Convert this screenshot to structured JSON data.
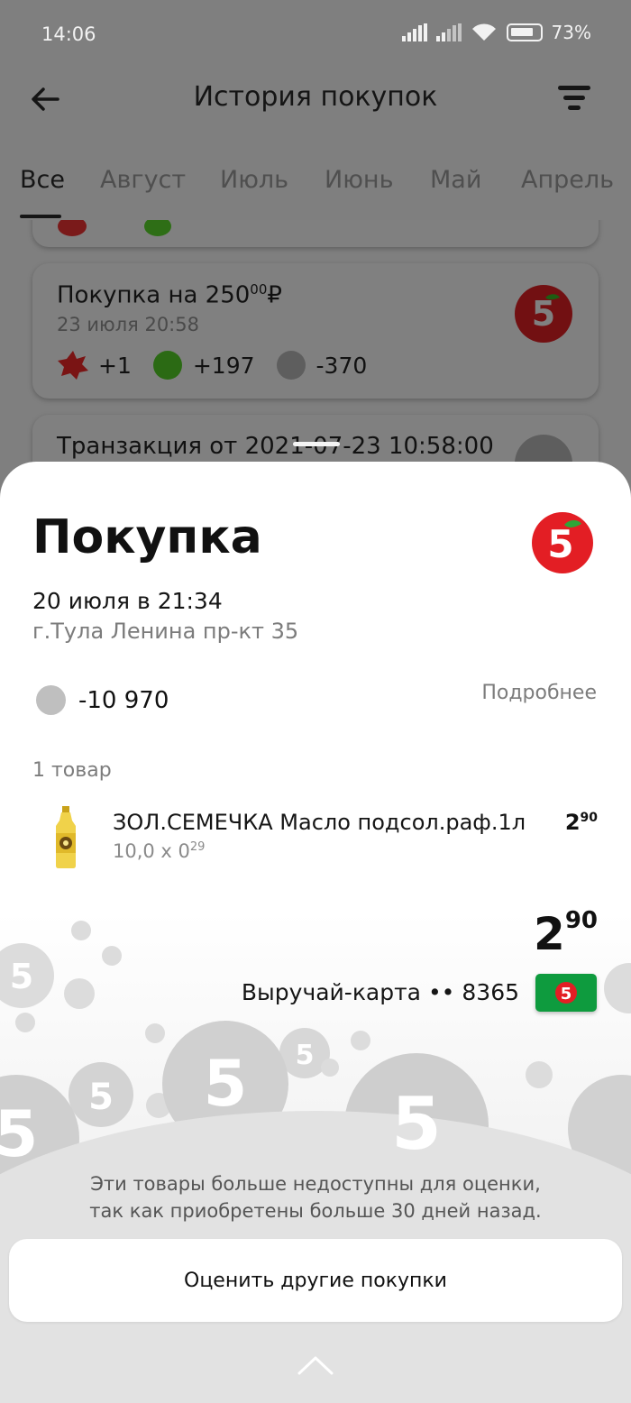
{
  "status_bar": {
    "time": "14:06",
    "battery": "73%"
  },
  "header": {
    "title": "История покупок"
  },
  "tabs": [
    "Все",
    "Август",
    "Июль",
    "Июнь",
    "Май",
    "Апрель"
  ],
  "purchases": [
    {
      "title": "Покупка на 250",
      "cents": "00",
      "currency": "₽",
      "date": "23 июля 20:58",
      "points": [
        "+1",
        "+197",
        "-370"
      ]
    },
    {
      "title": "Транзакция от 2021-07-23 10:58:00"
    }
  ],
  "sheet": {
    "title": "Покупка",
    "date": "20 июля в 21:34",
    "address": "г.Тула Ленина пр-кт 35",
    "balance": "-10 970",
    "details_link": "Подробнее",
    "items_count": "1 товар",
    "items": [
      {
        "name": "ЗОЛ.СЕМЕЧКА Масло подсол.раф.1л",
        "qty_main": "10,0 х 0",
        "qty_sup": "29",
        "price_main": "2",
        "price_sup": "90"
      }
    ],
    "total_main": "2",
    "total_sup": "90",
    "card_label": "Выручай-карта •• 8365",
    "notice_line1": "Эти товары больше недоступны для оценки,",
    "notice_line2": "так как приобретены больше 30 дней назад.",
    "rate_button": "Оценить другие покупки"
  },
  "colors": {
    "brand_red": "#e31e24",
    "brand_green": "#0e9b3e"
  }
}
